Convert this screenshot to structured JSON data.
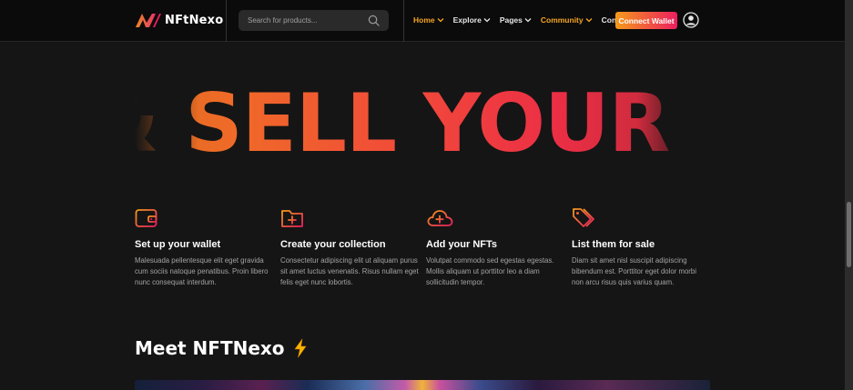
{
  "header": {
    "logo_text": "NFtNexo",
    "search_placeholder": "Search for products...",
    "nav": [
      {
        "label": "Home",
        "has_dropdown": true,
        "active": true
      },
      {
        "label": "Explore",
        "has_dropdown": true,
        "active": false
      },
      {
        "label": "Pages",
        "has_dropdown": true,
        "active": false
      },
      {
        "label": "Community",
        "has_dropdown": true,
        "active": true
      },
      {
        "label": "Contact",
        "has_dropdown": false,
        "active": false
      }
    ],
    "connect_label": "Connect Wallet"
  },
  "hero": {
    "marquee_text": "& SELL YOUR"
  },
  "steps": [
    {
      "icon": "wallet-icon",
      "title": "Set up your wallet",
      "desc": "Malesuada pellentesque elit eget gravida cum sociis natoque penatibus. Proin libero nunc consequat interdum."
    },
    {
      "icon": "folder-plus-icon",
      "title": "Create your collection",
      "desc": "Consectetur adipiscing elit ut aliquam purus sit amet luctus venenatis. Risus nullam eget felis eget nunc lobortis."
    },
    {
      "icon": "cloud-plus-icon",
      "title": "Add your NFTs",
      "desc": "Volutpat commodo sed egestas egestas. Mollis aliquam ut porttitor leo a diam sollicitudin tempor."
    },
    {
      "icon": "tags-icon",
      "title": "List them for sale",
      "desc": "Diam sit amet nisl suscipit adipiscing bibendum est. Porttitor eget dolor morbi non arcu risus quis varius quam."
    }
  ],
  "meet": {
    "title": "Meet NFTNexo"
  },
  "colors": {
    "accent_orange": "#f5a623",
    "gradient_start": "#f59a1b",
    "gradient_end": "#ec1e5f",
    "background": "#151515"
  }
}
